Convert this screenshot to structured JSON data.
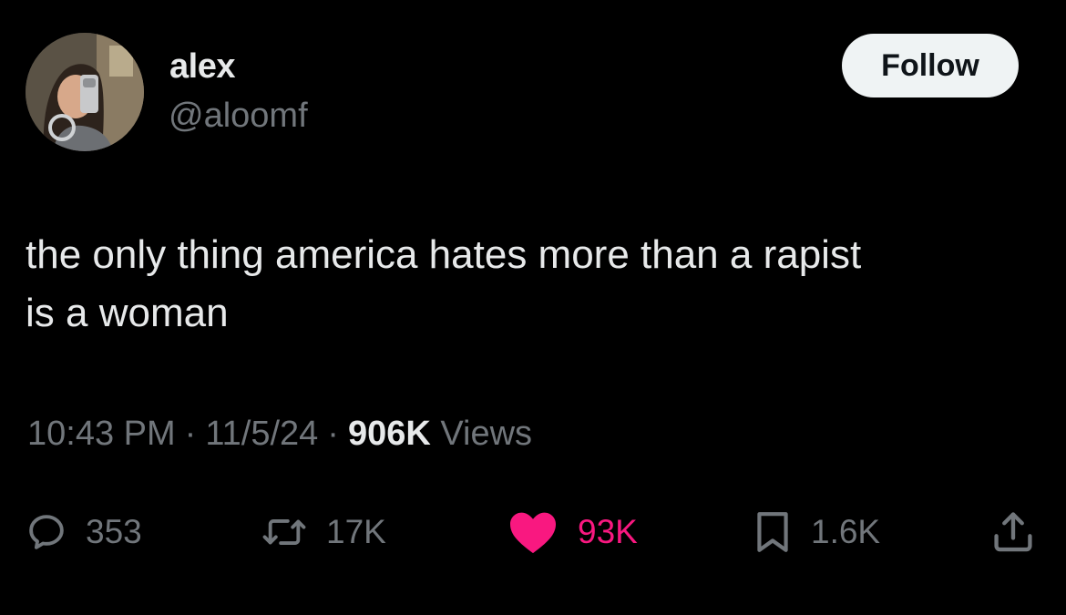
{
  "author": {
    "name": "alex",
    "handle": "@aloomf",
    "avatar_icon": "avatar-photo"
  },
  "follow_label": "Follow",
  "tweet": {
    "text": "the only thing america hates more than a rapist\nis a woman",
    "time": "10:43 PM",
    "date": "11/5/24",
    "views_count": "906K",
    "views_label": "Views",
    "separator": "·"
  },
  "actions": {
    "replies": {
      "count": "353",
      "icon": "reply-icon"
    },
    "reposts": {
      "count": "17K",
      "icon": "repost-icon"
    },
    "likes": {
      "count": "93K",
      "icon": "heart-icon",
      "color": "#f91880"
    },
    "bookmarks": {
      "count": "1.6K",
      "icon": "bookmark-icon"
    },
    "share": {
      "icon": "share-icon"
    }
  },
  "colors": {
    "background": "#000000",
    "text": "#e7e9ea",
    "secondary": "#71767b",
    "like": "#f91880",
    "follow_bg": "#eff3f4"
  }
}
